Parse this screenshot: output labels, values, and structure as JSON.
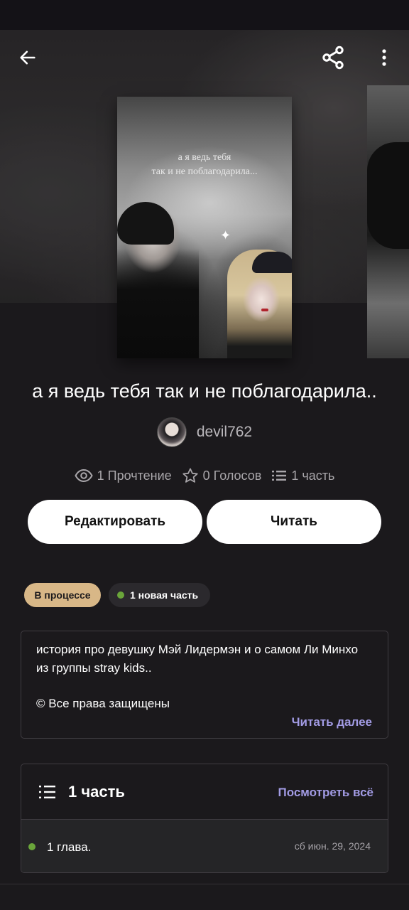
{
  "story": {
    "title": "а я ведь тебя так и не поблагодарила..",
    "cover_text_line1": "а я ведь тебя",
    "cover_text_line2": "так и не поблагодарила..."
  },
  "author": {
    "name": "devil762"
  },
  "stats": {
    "reads": "1 Прочтение",
    "votes": "0 Голосов",
    "parts": "1 часть"
  },
  "buttons": {
    "edit_label": "Редактировать",
    "read_label": "Читать"
  },
  "tags": {
    "status": "В процессе",
    "new_parts": "1 новая часть"
  },
  "description": {
    "text": "история про девушку Мэй Лидермэн и о самом Ли Минхо из группы stray kids..",
    "copyright": "© Все права защищены",
    "more_label": "Читать далее"
  },
  "parts_section": {
    "title": "1 часть",
    "see_all_label": "Посмотреть всё",
    "items": [
      {
        "title": "1 глава.",
        "date": "сб июн. 29, 2024"
      }
    ]
  },
  "icons": {
    "back": "arrow-left-icon",
    "share": "share-icon",
    "more": "more-vertical-icon",
    "eye": "eye-icon",
    "star": "star-icon",
    "list": "list-icon"
  },
  "colors": {
    "background": "#1b191c",
    "accent_link": "#a29be4",
    "status_chip": "#d8b787",
    "new_dot": "#6aa53a"
  }
}
